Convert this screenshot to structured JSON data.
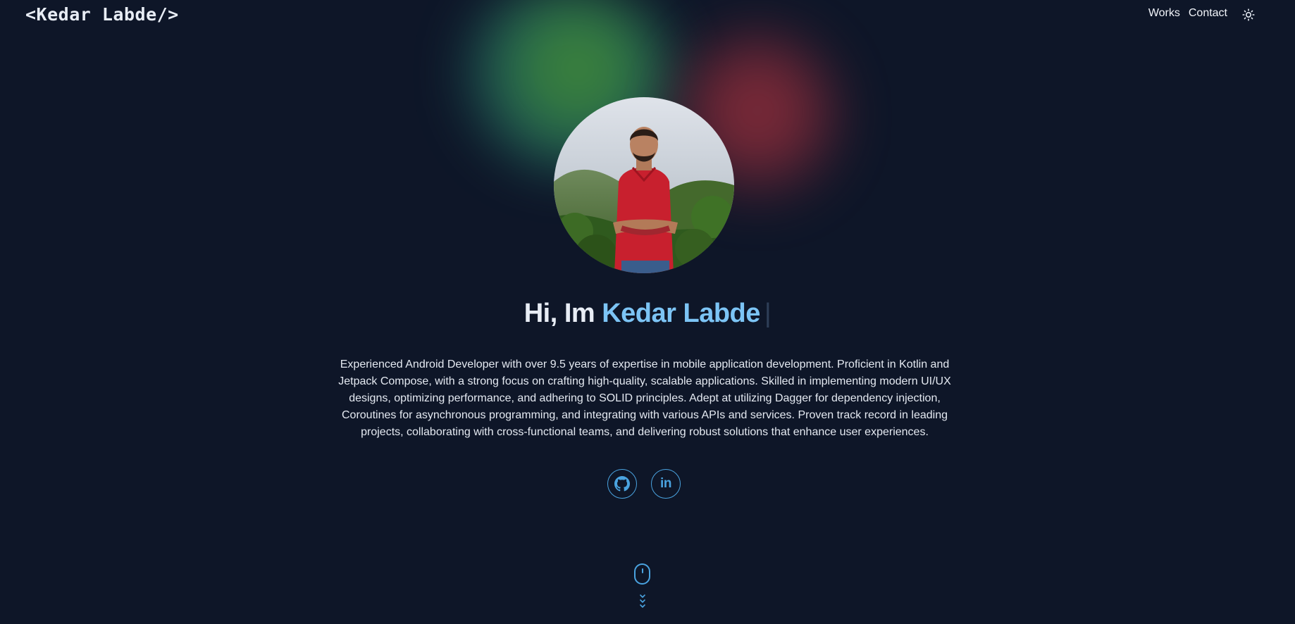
{
  "header": {
    "logo": "<Kedar Labde/>",
    "nav": [
      {
        "label": "Works"
      },
      {
        "label": "Contact"
      }
    ],
    "theme_toggle_icon": "sun-icon"
  },
  "hero": {
    "avatar_alt": "profile-photo",
    "greeting": "Hi, Im",
    "name": "Kedar Labde",
    "cursor": "|",
    "bio": "Experienced Android Developer with over 9.5 years of expertise in mobile application development. Proficient in Kotlin and Jetpack Compose, with a strong focus on crafting high-quality, scalable applications. Skilled in implementing modern UI/UX designs, optimizing performance, and adhering to SOLID principles. Adept at utilizing Dagger for dependency injection, Coroutines for asynchronous programming, and integrating with various APIs and services. Proven track record in leading projects, collaborating with cross-functional teams, and delivering robust solutions that enhance user experiences."
  },
  "social": [
    {
      "icon": "github-icon"
    },
    {
      "icon": "linkedin-icon",
      "glyph": "in"
    }
  ],
  "scroll_indicator": {
    "icon": "mouse-icon"
  },
  "colors": {
    "background": "#0e1628",
    "accent": "#4aa3e0",
    "name_highlight": "#7cc4f5",
    "text": "#e8edf5"
  }
}
